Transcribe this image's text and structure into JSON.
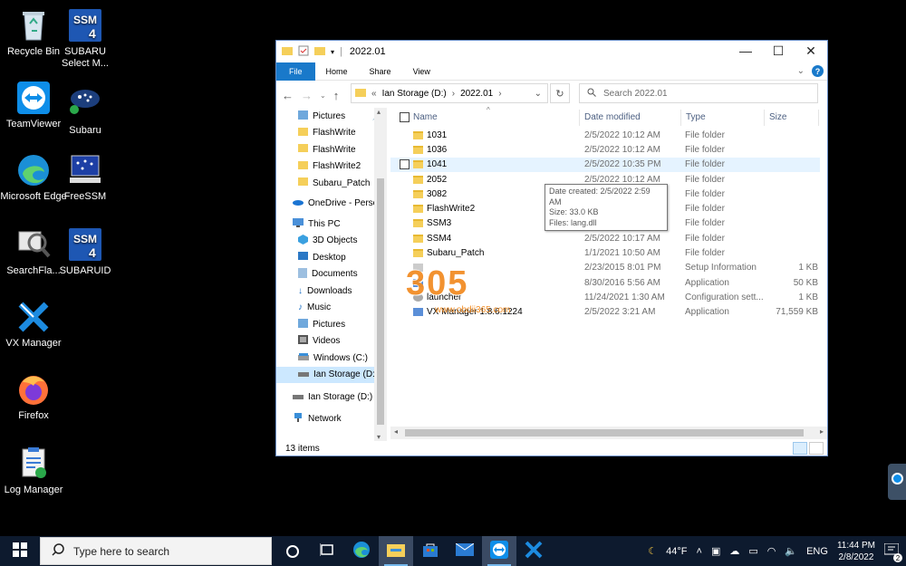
{
  "desktop": {
    "icons": [
      {
        "label": "Recycle Bin"
      },
      {
        "label": "SUBARU Select M..."
      },
      {
        "label": "TeamViewer"
      },
      {
        "label": "Subaru"
      },
      {
        "label": "Microsoft Edge"
      },
      {
        "label": "FreeSSM"
      },
      {
        "label": "SearchFla..."
      },
      {
        "label": "SUBARUID"
      },
      {
        "label": "VX Manager"
      },
      {
        "label": "Firefox"
      },
      {
        "label": "Log Manager"
      }
    ]
  },
  "window": {
    "title": "2022.01",
    "ribbon_tabs": [
      "File",
      "Home",
      "Share",
      "View"
    ],
    "address": {
      "prefix": "«",
      "segments": [
        "Ian Storage (D:)",
        "2022.01"
      ]
    },
    "search_placeholder": "Search 2022.01",
    "nav": [
      {
        "label": "Pictures",
        "pinned": true
      },
      {
        "label": "FlashWrite"
      },
      {
        "label": "FlashWrite"
      },
      {
        "label": "FlashWrite2"
      },
      {
        "label": "Subaru_Patch"
      },
      {
        "label": "OneDrive - Person"
      },
      {
        "label": "This PC"
      },
      {
        "label": "3D Objects"
      },
      {
        "label": "Desktop"
      },
      {
        "label": "Documents"
      },
      {
        "label": "Downloads"
      },
      {
        "label": "Music"
      },
      {
        "label": "Pictures"
      },
      {
        "label": "Videos"
      },
      {
        "label": "Windows (C:)"
      },
      {
        "label": "Ian Storage (D:)",
        "selected": true
      },
      {
        "label": "Ian Storage (D:)"
      },
      {
        "label": "Network"
      }
    ],
    "columns": {
      "name": "Name",
      "date": "Date modified",
      "type": "Type",
      "size": "Size"
    },
    "files": [
      {
        "name": "1031",
        "date": "2/5/2022 10:12 AM",
        "type": "File folder",
        "size": "",
        "kind": "folder"
      },
      {
        "name": "1036",
        "date": "2/5/2022 10:12 AM",
        "type": "File folder",
        "size": "",
        "kind": "folder"
      },
      {
        "name": "1041",
        "date": "2/5/2022 10:35 PM",
        "type": "File folder",
        "size": "",
        "kind": "folder",
        "hover": true
      },
      {
        "name": "2052",
        "date": "2/5/2022 10:12 AM",
        "type": "File folder",
        "size": "",
        "kind": "folder"
      },
      {
        "name": "3082",
        "date": "",
        "type": "File folder",
        "size": "",
        "kind": "folder"
      },
      {
        "name": "FlashWrite2",
        "date": "",
        "type": "File folder",
        "size": "",
        "kind": "folder"
      },
      {
        "name": "SSM3",
        "date": "2/5/2022 10:13 AM",
        "type": "File folder",
        "size": "",
        "kind": "folder"
      },
      {
        "name": "SSM4",
        "date": "2/5/2022 10:17 AM",
        "type": "File folder",
        "size": "",
        "kind": "folder"
      },
      {
        "name": "Subaru_Patch",
        "date": "1/1/2021 10:50 AM",
        "type": "File folder",
        "size": "",
        "kind": "folder"
      },
      {
        "name": "",
        "date": "2/23/2015 8:01 PM",
        "type": "Setup Information",
        "size": "1 KB",
        "kind": "file"
      },
      {
        "name": "",
        "date": "8/30/2016 5:56 AM",
        "type": "Application",
        "size": "50 KB",
        "kind": "app"
      },
      {
        "name": "launcher",
        "date": "11/24/2021 1:30 AM",
        "type": "Configuration sett...",
        "size": "1 KB",
        "kind": "config"
      },
      {
        "name": "VX Manager 1.8.6.1224",
        "date": "2/5/2022 3:21 AM",
        "type": "Application",
        "size": "71,559 KB",
        "kind": "app"
      }
    ],
    "tooltip": {
      "line1": "Date created: 2/5/2022 2:59 AM",
      "line2": "Size: 33.0 KB",
      "line3": "Files: lang.dll"
    },
    "status": "13 items"
  },
  "watermark": {
    "text": "305",
    "sub": "www.obdii365.com"
  },
  "taskbar": {
    "search_placeholder": "Type here to search",
    "weather": "44°F",
    "lang": "ENG",
    "time": "11:44 PM",
    "date": "2/8/2022"
  },
  "colors": {
    "accent": "#1979ca",
    "folder": "#f5cf5a",
    "taskbar": "#0d1a2e",
    "selection": "#cce8ff"
  }
}
